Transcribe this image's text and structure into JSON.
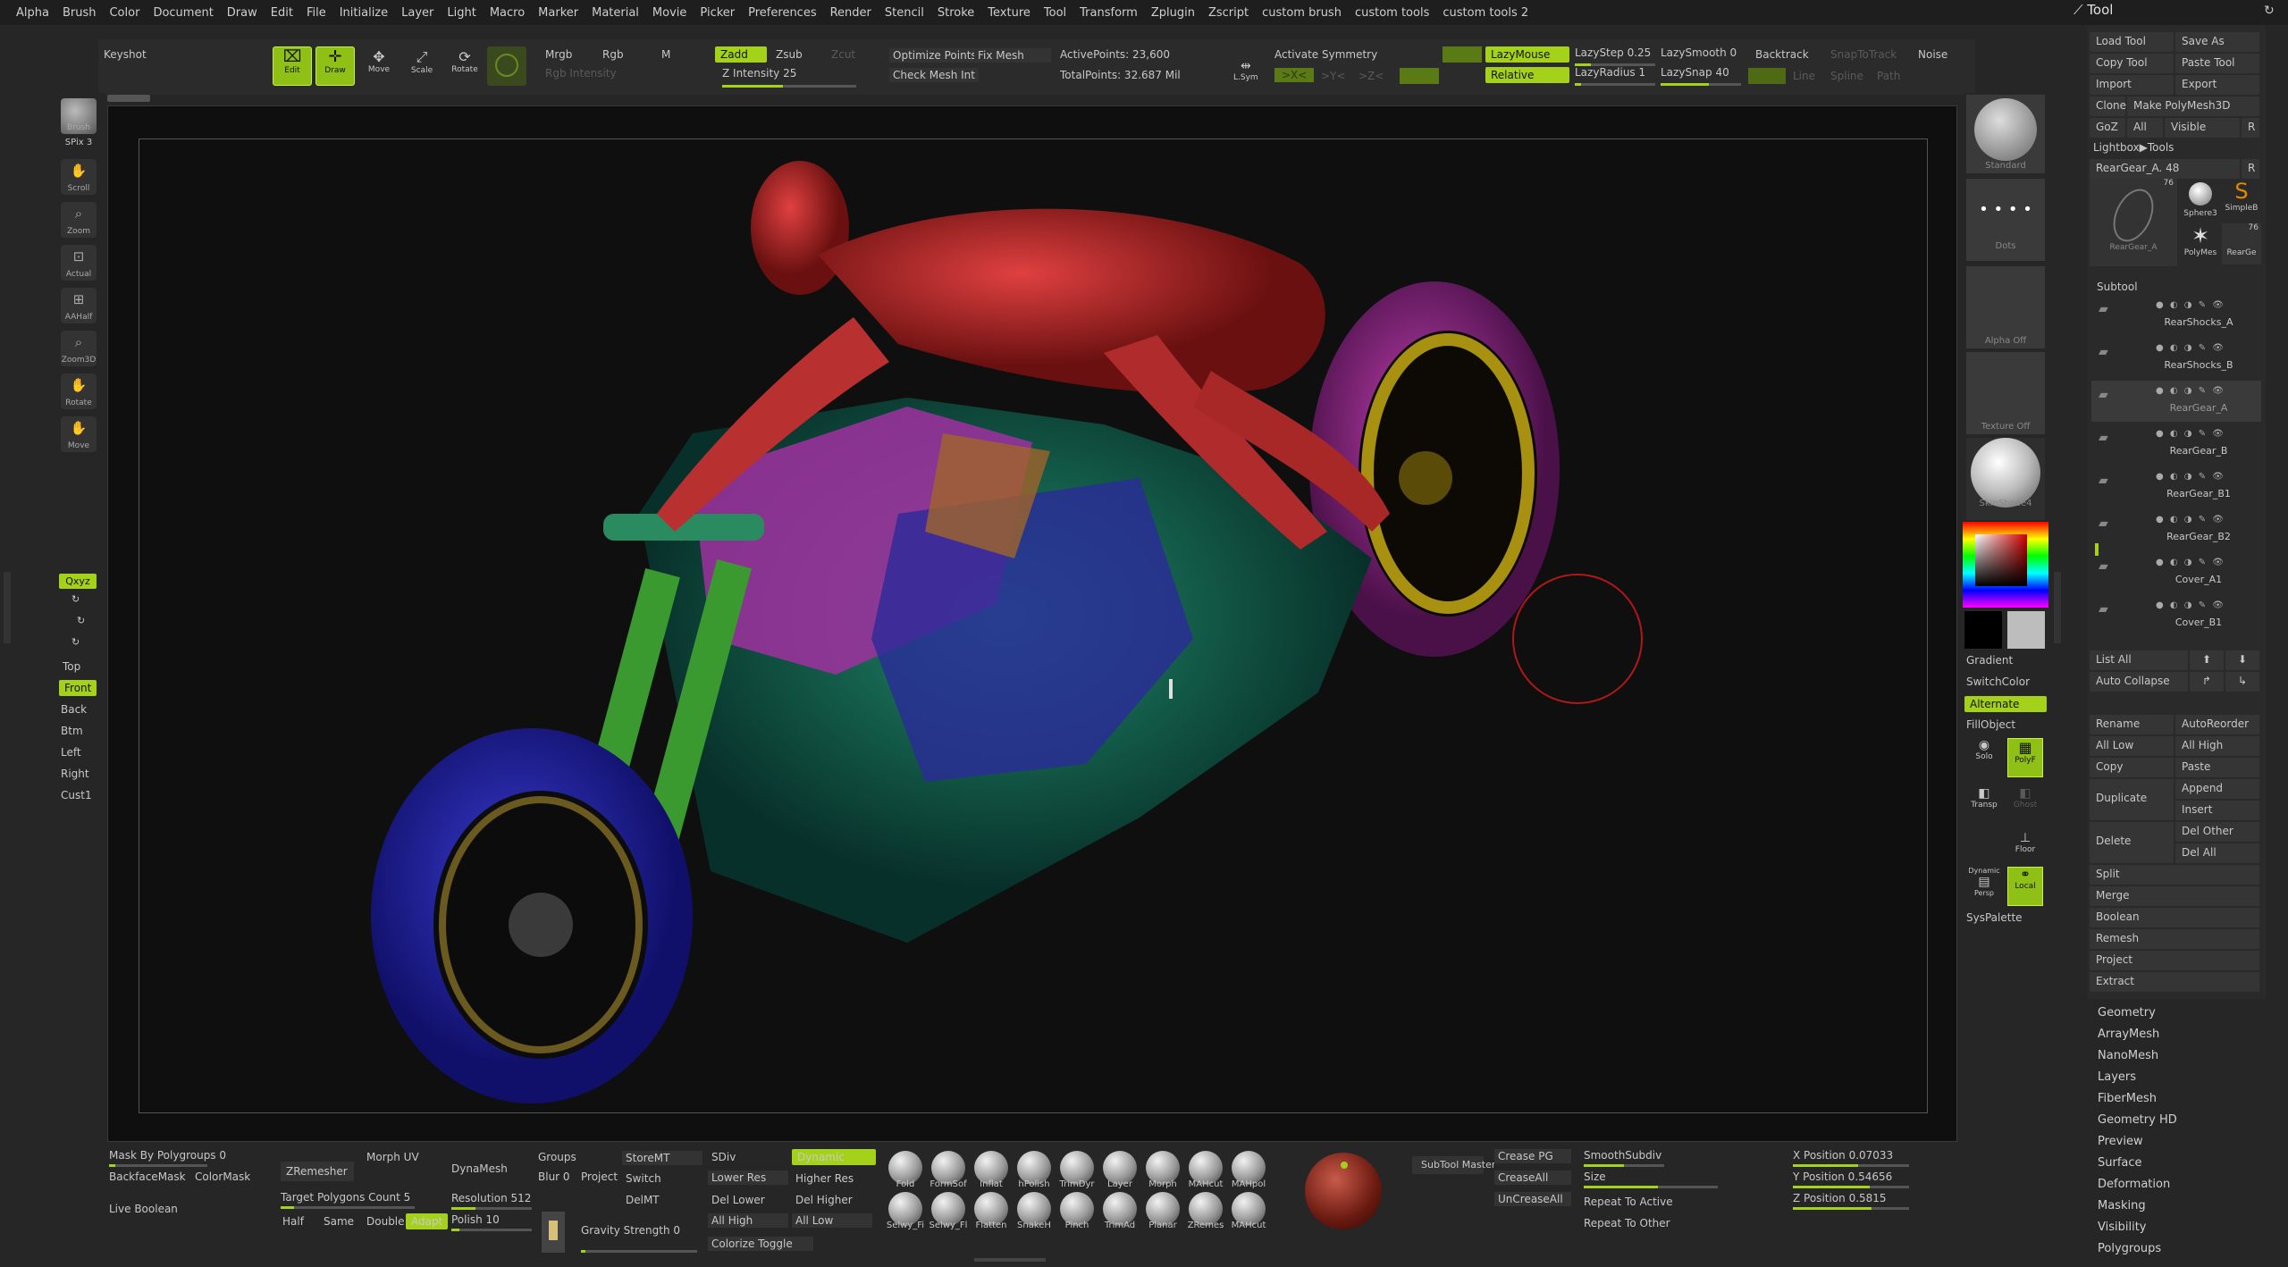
{
  "menu": [
    "Alpha",
    "Brush",
    "Color",
    "Document",
    "Draw",
    "Edit",
    "File",
    "Initialize",
    "Layer",
    "Light",
    "Macro",
    "Marker",
    "Material",
    "Movie",
    "Picker",
    "Preferences",
    "Render",
    "Stencil",
    "Stroke",
    "Texture",
    "Tool",
    "Transform",
    "Zplugin",
    "Zscript",
    "custom brush",
    "custom tools",
    "custom tools 2"
  ],
  "top": {
    "keyshot": "Keyshot",
    "edit": "Edit",
    "draw": "Draw",
    "move": "Move",
    "scale": "Scale",
    "rotate": "Rotate",
    "mrgb": "Mrgb",
    "rgb": "Rgb",
    "m": "M",
    "rgb_intensity": "Rgb Intensity",
    "zadd": "Zadd",
    "zsub": "Zsub",
    "zcut": "Zcut",
    "z_intensity": "Z Intensity 25",
    "optimize_points": "Optimize Points",
    "fix_mesh": "Fix Mesh",
    "check_mesh": "Check Mesh Int",
    "active_points": "ActivePoints: 23,600",
    "total_points": "TotalPoints: 32.687 Mil",
    "lsym": "L.Sym",
    "activate_symmetry": "Activate Symmetry",
    "lazymouse": "LazyMouse",
    "relative": "Relative",
    "lazystep": "LazyStep 0.25",
    "lazysmooth": "LazySmooth 0",
    "lazyradius": "LazyRadius 1",
    "lazysnap": "LazySnap 40",
    "backtrack": "Backtrack",
    "snaptotrack": "SnapToTrack",
    "line": "Line",
    "spline": "Spline",
    "path": "Path",
    "noise": "Noise",
    "x": ">X<",
    "y": ">Y<",
    "z": ">Z<"
  },
  "left_shelf": {
    "brush": "Brush",
    "spix": "SPix 3",
    "scroll": "Scroll",
    "zoom": "Zoom",
    "actual": "Actual",
    "aahalf": "AAHalf",
    "zoom3d": "Zoom3D",
    "rotate": "Rotate",
    "move": "Move",
    "xyz": "Qxyz",
    "top": "Top",
    "front": "Front",
    "back": "Back",
    "btm": "Btm",
    "left": "Left",
    "right": "Right",
    "cust1": "Cust1"
  },
  "right_shelf": {
    "standard": "Standard",
    "dots": "Dots",
    "alpha_off": "Alpha Off",
    "texture_off": "Texture Off",
    "skinshade": "SkinShade4",
    "gradient": "Gradient",
    "switchcolor": "SwitchColor",
    "alternate": "Alternate",
    "fillobject": "FillObject",
    "solo": "Solo",
    "polyf": "PolyF",
    "transp": "Transp",
    "ghost": "Ghost",
    "floor": "Floor",
    "dynamic": "Dynamic",
    "persp": "Persp",
    "local": "Local",
    "syspalette": "SysPalette"
  },
  "tool": {
    "title": "Tool",
    "load": "Load Tool",
    "save_as": "Save As",
    "copy_tool": "Copy Tool",
    "paste_tool": "Paste Tool",
    "import": "Import",
    "export": "Export",
    "clone": "Clone",
    "make_polymesh": "Make PolyMesh3D",
    "goz": "GoZ",
    "all": "All",
    "visible": "Visible",
    "r": "R",
    "lightbox": "Lightbox▶Tools",
    "current": "RearGear_A. 48",
    "thumb_count": "76",
    "thumb_count2": "76",
    "sphere": "Sphere3",
    "simpleb": "SimpleB",
    "polymesh": "PolyMes",
    "reargear_a": "RearGear_A",
    "reargear_thumb": "RearGe"
  },
  "subtool": {
    "header": "Subtool",
    "items": [
      "RearShocks_A",
      "RearShocks_B",
      "RearGear_A",
      "RearGear_B",
      "RearGear_B1",
      "RearGear_B2",
      "Cover_A1",
      "Cover_B1"
    ],
    "list_all": "List All",
    "auto_collapse": "Auto Collapse",
    "rename": "Rename",
    "autoreorder": "AutoReorder",
    "all_low": "All Low",
    "all_high": "All High",
    "copy": "Copy",
    "paste": "Paste",
    "duplicate": "Duplicate",
    "append": "Append",
    "insert": "Insert",
    "delete": "Delete",
    "del_other": "Del Other",
    "del_all": "Del All",
    "split": "Split",
    "merge": "Merge",
    "boolean": "Boolean",
    "remesh": "Remesh",
    "project": "Project",
    "extract": "Extract"
  },
  "palette": [
    "Geometry",
    "ArrayMesh",
    "NanoMesh",
    "Layers",
    "FiberMesh",
    "Geometry HD",
    "Preview",
    "Surface",
    "Deformation",
    "Masking",
    "Visibility",
    "Polygroups"
  ],
  "bottom": {
    "mask_polygroups": "Mask By Polygroups 0",
    "backfacemask": "BackfaceMask",
    "colormask": "ColorMask",
    "live_boolean": "Live Boolean",
    "zremesher": "ZRemesher",
    "morph_uv": "Morph UV",
    "target_polys": "Target Polygons Count 5",
    "half": "Half",
    "same": "Same",
    "double": "Double",
    "adapt": "Adapt",
    "dynamesh": "DynaMesh",
    "groups": "Groups",
    "blur": "Blur 0",
    "project": "Project",
    "resolution": "Resolution 512",
    "polish": "Polish 10",
    "storemt": "StoreMT",
    "switch": "Switch",
    "delmt": "DelMT",
    "gravity": "Gravity Strength 0",
    "sdiv": "SDiv",
    "lower_res": "Lower Res",
    "higher_res": "Higher Res",
    "del_lower": "Del Lower",
    "del_higher": "Del Higher",
    "all_high": "All High",
    "all_low": "All Low",
    "colorize_toggle": "Colorize Toggle",
    "dynamic": "Dynamic",
    "brushes_row1": [
      "Fold",
      "FormSof",
      "Inflat",
      "hPolish",
      "TrimDyr",
      "Layer",
      "Morph",
      "MAHcut",
      "MAHpol"
    ],
    "brushes_row2": [
      "Selwy_Fi",
      "Selwy_Fl",
      "Flatten",
      "SnakeH",
      "Pinch",
      "TrimAd",
      "Planar",
      "ZRemes",
      "MAHcut"
    ],
    "subtool_master": "SubTool Master",
    "crease_pg": "Crease PG",
    "creaseall": "CreaseAll",
    "uncreaseall": "UnCreaseAll",
    "smoothsubdiv": "SmoothSubdiv",
    "size": "Size",
    "repeat_active": "Repeat To Active",
    "repeat_other": "Repeat To Other",
    "x_pos": "X Position 0.07033",
    "y_pos": "Y Position 0.54656",
    "z_pos": "Z Position 0.5815"
  },
  "colors": {
    "accent": "#a4d21b",
    "figure": "#c03030",
    "tire_front": "#2a2ab8",
    "tire_rear": "#a0309a",
    "rim": "#b09a10"
  }
}
